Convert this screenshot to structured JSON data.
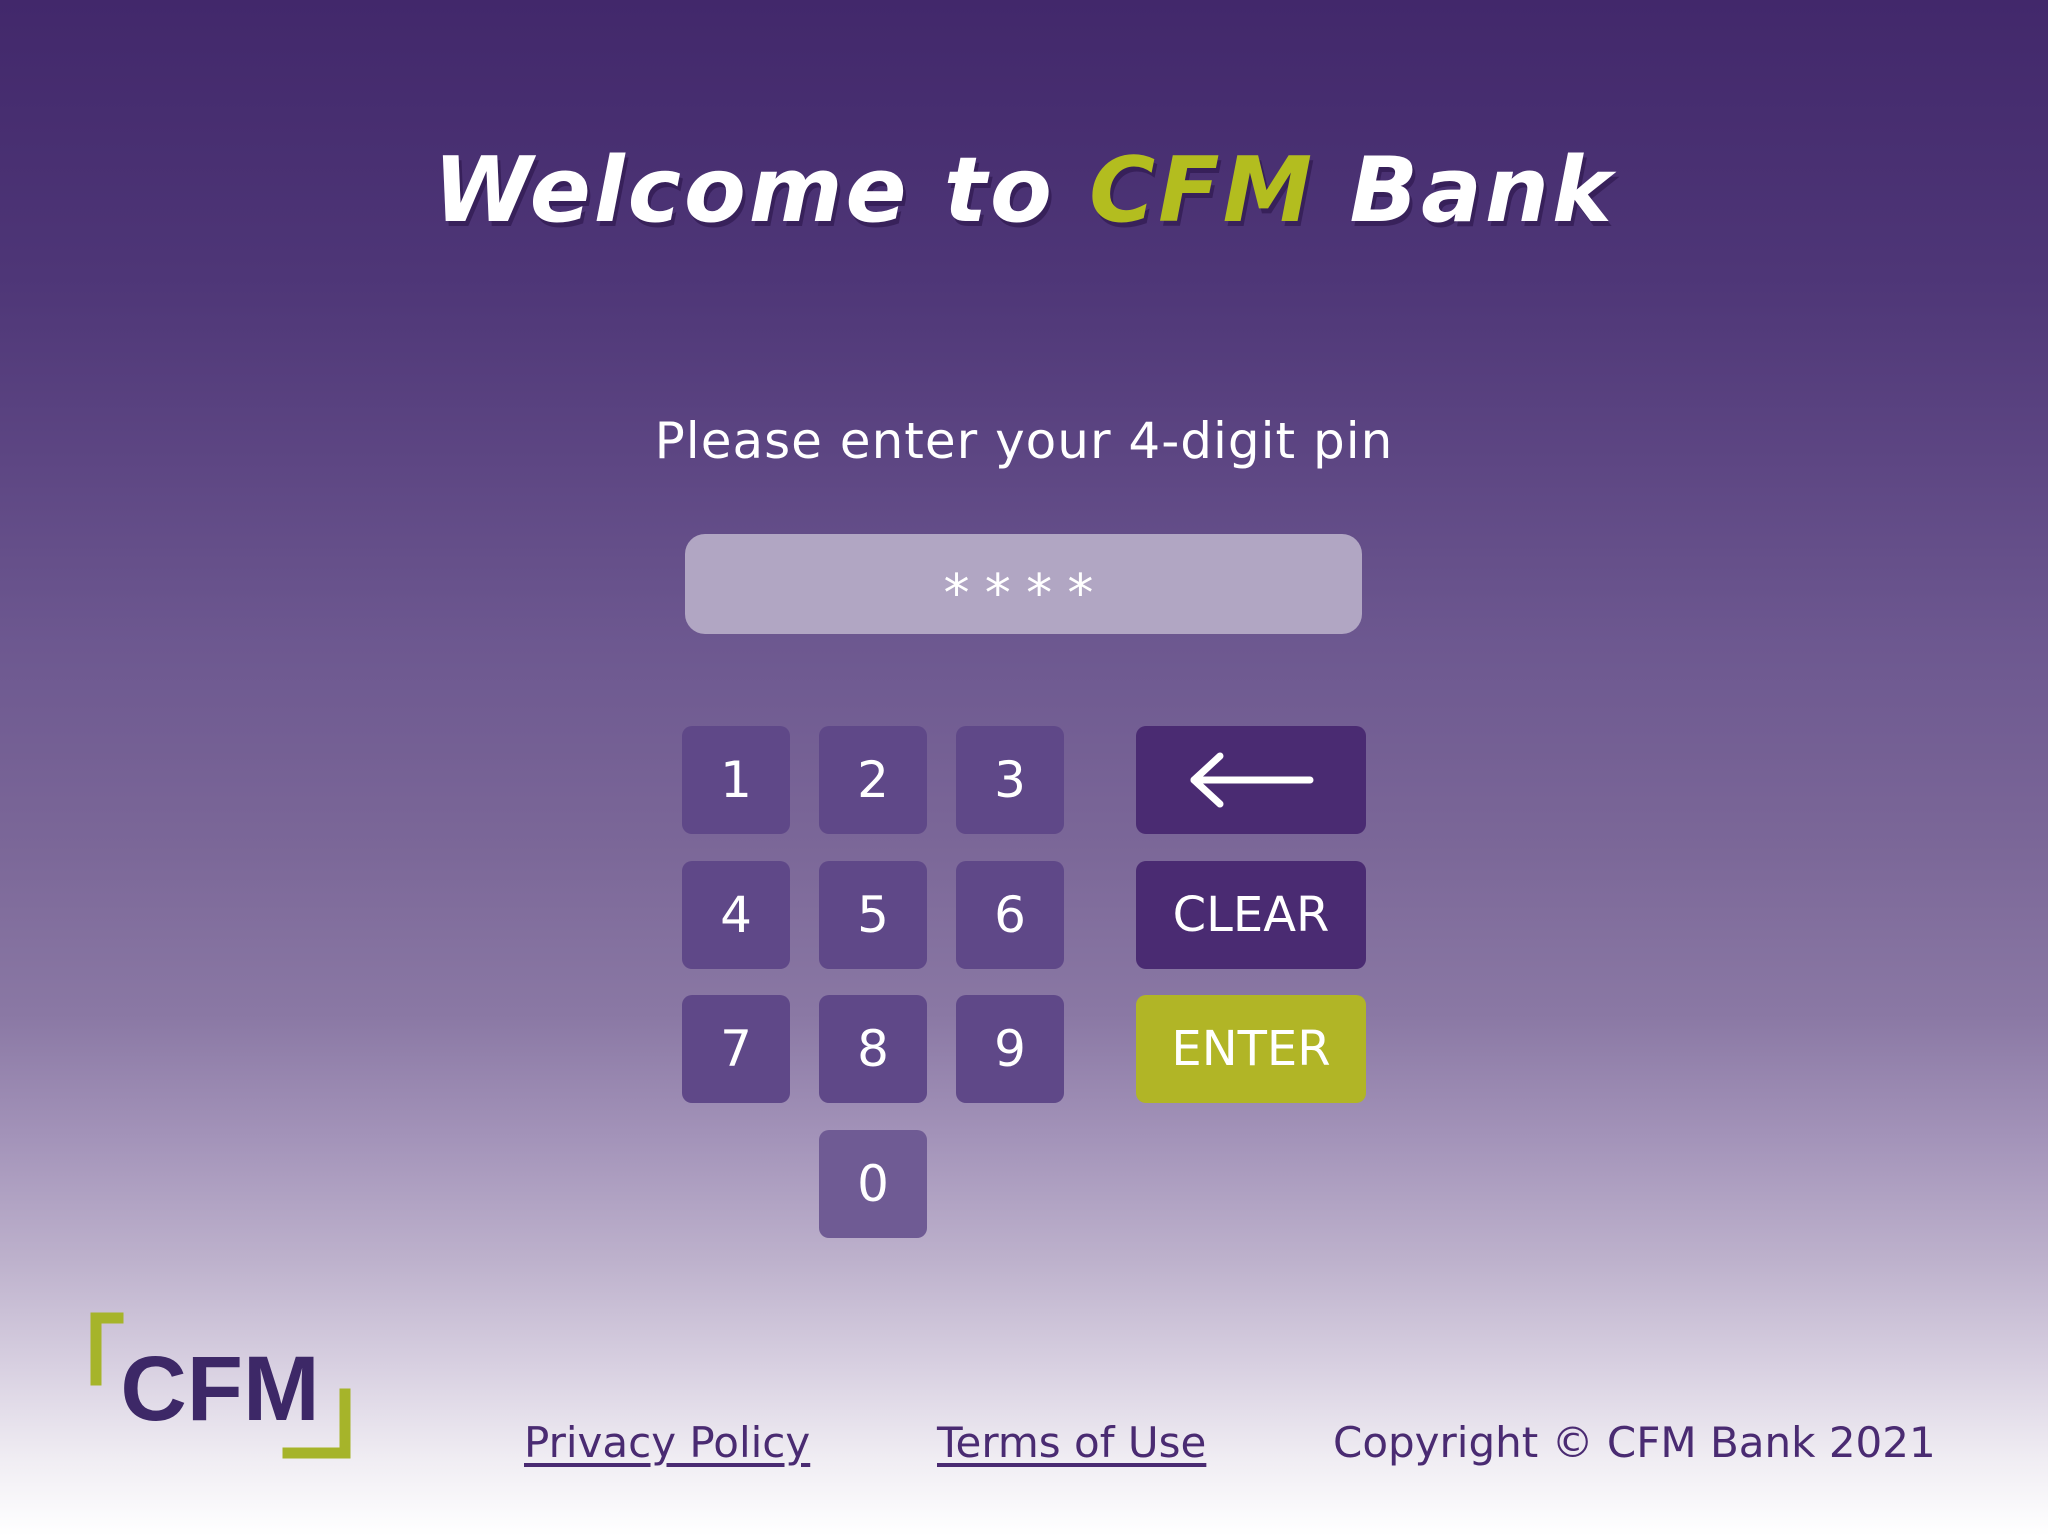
{
  "header": {
    "title_prefix": "Welcome to ",
    "title_brand": "CFM",
    "title_suffix": " Bank"
  },
  "prompt": "Please enter your 4-digit pin",
  "pin_field": {
    "value": "****"
  },
  "keypad": {
    "keys": [
      "1",
      "2",
      "3",
      "4",
      "5",
      "6",
      "7",
      "8",
      "9",
      "0"
    ],
    "backspace_icon": "left-arrow-icon",
    "clear_label": "CLEAR",
    "enter_label": "ENTER"
  },
  "logo": {
    "text": "CFM",
    "bracket_color": "#a6b42a",
    "text_color": "#3d2867"
  },
  "footer": {
    "privacy_label": "Privacy Policy",
    "terms_label": "Terms of Use",
    "copyright": "Copyright © CFM Bank 2021"
  },
  "colors": {
    "brand_purple": "#4a2b72",
    "accent_green": "#b3bd1f",
    "key_purple": "#5f4888"
  }
}
